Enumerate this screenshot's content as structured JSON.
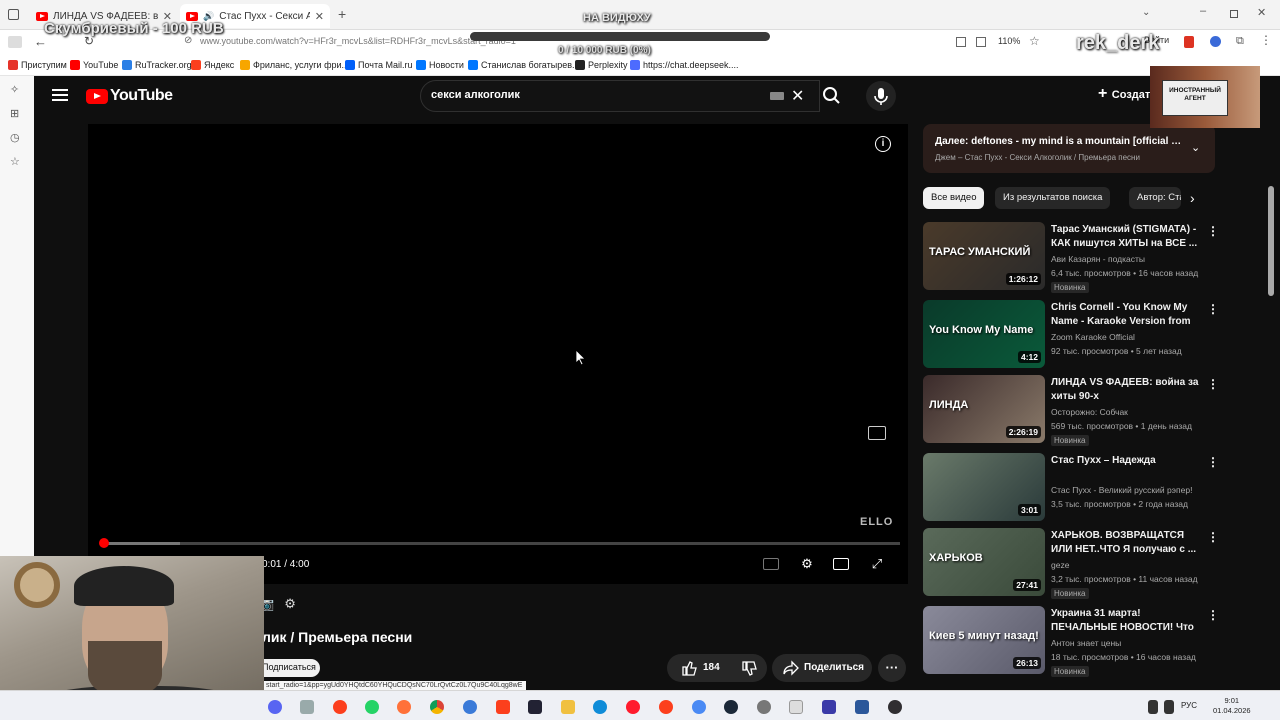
{
  "browser": {
    "tabs": [
      {
        "label": "ЛИНДА VS ФАДЕЕВ: война за"
      },
      {
        "label": "Стас Пухх - Секси Алкогол"
      }
    ],
    "url": "www.youtube.com/watch?v=HFr3r_mcvLs&list=RDHFr3r_mcvLs&start_radio=1",
    "zoom": "110%",
    "login_label": "Войти",
    "bookmarks": [
      {
        "label": "Приступим",
        "color": "#e6332a"
      },
      {
        "label": "YouTube",
        "color": "#ff0000"
      },
      {
        "label": "RuTracker.org",
        "color": "#2a7fe6"
      },
      {
        "label": "Яндекс",
        "color": "#fc3f1d"
      },
      {
        "label": "Фриланс, услуги фри...",
        "color": "#f7a600"
      },
      {
        "label": "Почта Mail.ru",
        "color": "#005ff9"
      },
      {
        "label": "Новости",
        "color": "#0077ff"
      },
      {
        "label": "Станислав богатырев...",
        "color": "#0077ff"
      },
      {
        "label": "Perplexity",
        "color": "#222222"
      },
      {
        "label": "https://chat.deepseek....",
        "color": "#4d6bfe"
      }
    ]
  },
  "overlay": {
    "donation_top_left": "Скумбриевый - 100 RUB",
    "on_video": "НА ВИДЮХУ",
    "donation_progress": "0 / 10 000 RUB (0%)",
    "donation_fraction": 0,
    "streamer_name": "rek_derk",
    "stamp_text": "ИНОСТРАННЫЙ АГЕНТ"
  },
  "youtube": {
    "logo_text": "YouTube",
    "search_value": "секси алкоголик",
    "create_label": "Создать",
    "player": {
      "time": "0:01 / 4:00",
      "progress_fraction": 0.004,
      "buffered_fraction": 0.1,
      "watermark": "ELLO"
    },
    "title": "лик / Премьера песни",
    "subscribe_label": "Подписаться",
    "likes": "184",
    "share_label": "Поделиться",
    "status_url": "start_radio=1&pp=ygUd0YHQtdC60YHQuCDQsNC70LrQvtCz0L7Qu9C40Lqg8wE",
    "up_next": {
      "title": "Далее: deftones - my mind is a mountain [official m...",
      "subtitle": "Джем – Стас Пухх - Секси Алкоголик / Премьера песни"
    },
    "chips": [
      "Все видео",
      "Из результатов поиска",
      "Автор: Стас Пухх"
    ],
    "recommendations": [
      {
        "title": "Тарас Уманский (STIGMATA) - КАК пишутся ХИТЫ на ВСЕ ...",
        "channel": "Ави Казарян - подкасты",
        "meta": "6,4 тыс. просмотров • 16 часов назад",
        "badge": "Новинка",
        "duration": "1:26:12",
        "thumb_text": "ТАРАС УМАНСКИЙ",
        "thumb_colors": [
          "#4a3a2a",
          "#2a2a2a"
        ]
      },
      {
        "title": "Chris Cornell - You Know My Name - Karaoke Version from ...",
        "channel": "Zoom Karaoke Official",
        "meta": "92 тыс. просмотров • 5 лет назад",
        "badge": "",
        "duration": "4:12",
        "thumb_text": "You Know My Name",
        "thumb_colors": [
          "#0a3a2a",
          "#0a5a3a"
        ]
      },
      {
        "title": "ЛИНДА VS ФАДЕЕВ: война за хиты 90-х",
        "channel": "Осторожно: Собчак",
        "meta": "569 тыс. просмотров • 1 день назад",
        "badge": "Новинка",
        "duration": "2:26:19",
        "thumb_text": "ЛИНДА",
        "thumb_colors": [
          "#3a2a2a",
          "#8a7a6a"
        ]
      },
      {
        "title": "Стас Пухх – Надежда",
        "channel": "Стас Пухх - Великий русский рэпер!",
        "meta": "3,5 тыс. просмотров • 2 года назад",
        "badge": "",
        "duration": "3:01",
        "thumb_text": "",
        "thumb_colors": [
          "#6a7a6a",
          "#2a3a3a"
        ]
      },
      {
        "title": "ХАРЬКОВ. ВОЗВРАЩАТСЯ ИЛИ НЕТ..ЧТО Я получаю с ...",
        "channel": "geze",
        "meta": "3,2 тыс. просмотров • 11 часов назад",
        "badge": "Новинка",
        "duration": "27:41",
        "thumb_text": "ХАРЬКОВ",
        "thumb_colors": [
          "#5a6a5a",
          "#3a4a3a"
        ]
      },
      {
        "title": "Украина 31 марта! ПЕЧАЛЬНЫЕ НОВОСТИ! Что ...",
        "channel": "Антон знает цены",
        "meta": "18 тыс. просмотров • 16 часов назад",
        "badge": "Новинка",
        "duration": "26:13",
        "thumb_text": "Киев 5 минут назад!",
        "thumb_colors": [
          "#8a8a9a",
          "#5a5a6a"
        ]
      }
    ]
  },
  "taskbar": {
    "lang": "РУС",
    "time": "9:01",
    "date": "01.04.2026"
  }
}
